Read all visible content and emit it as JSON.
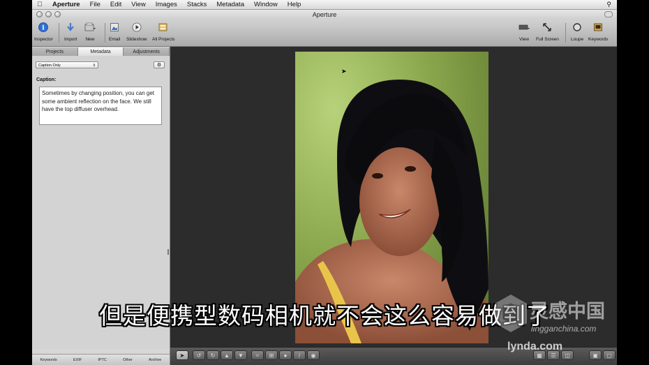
{
  "menubar": {
    "app": "Aperture",
    "items": [
      "File",
      "Edit",
      "View",
      "Images",
      "Stacks",
      "Metadata",
      "Window",
      "Help"
    ]
  },
  "window": {
    "title": "Aperture"
  },
  "toolbar": {
    "inspector": "Inspector",
    "import": "Import",
    "new": "New",
    "email": "Email",
    "slideshow": "Slideshow",
    "all_projects": "All Projects",
    "view": "View",
    "full_screen": "Full Screen",
    "loupe": "Loupe",
    "keywords": "Keywords"
  },
  "sidebar": {
    "tabs": [
      "Projects",
      "Metadata",
      "Adjustments"
    ],
    "active_tab": "Metadata",
    "preset": "Caption Only",
    "caption_label": "Caption:",
    "caption_text": "Sometimes by changing position, you can get some ambient reflection on the face. We still have the top diffuser overhead.",
    "bottom_tabs": [
      "Keywords",
      "EXIF",
      "IPTC",
      "Other",
      "Archive"
    ]
  },
  "subtitle": "但是便携型数码相机就不会这么容易做到了",
  "watermark": {
    "title": "灵感中国",
    "url": "lingganchina.com",
    "brand": "lynda.com"
  },
  "colors": {
    "viewer_bg": "#2c2c2c",
    "sidebar_bg": "#d3d3d3",
    "inspector_blue": "#2f6fd6"
  }
}
